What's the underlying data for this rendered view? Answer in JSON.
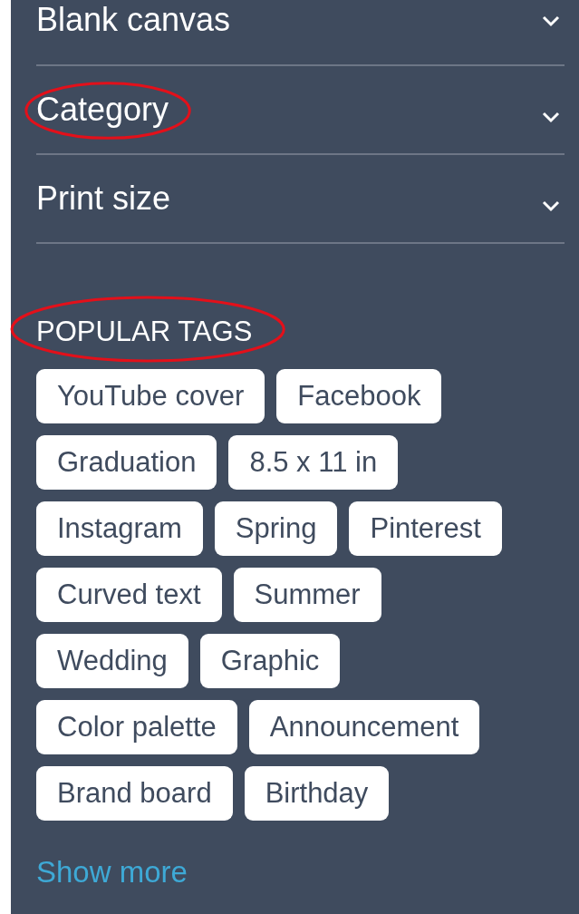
{
  "filters": [
    {
      "label": "Blank canvas",
      "expanded": false,
      "highlighted": false
    },
    {
      "label": "Category",
      "expanded": false,
      "highlighted": true
    },
    {
      "label": "Print size",
      "expanded": false,
      "highlighted": false
    }
  ],
  "popular_tags": {
    "heading": "POPULAR TAGS",
    "highlighted": true,
    "tags": [
      "YouTube cover",
      "Facebook",
      "Graduation",
      "8.5 x 11 in",
      "Instagram",
      "Spring",
      "Pinterest",
      "Curved text",
      "Summer",
      "Wedding",
      "Graphic",
      "Color palette",
      "Announcement",
      "Brand board",
      "Birthday"
    ],
    "show_more": "Show more"
  }
}
